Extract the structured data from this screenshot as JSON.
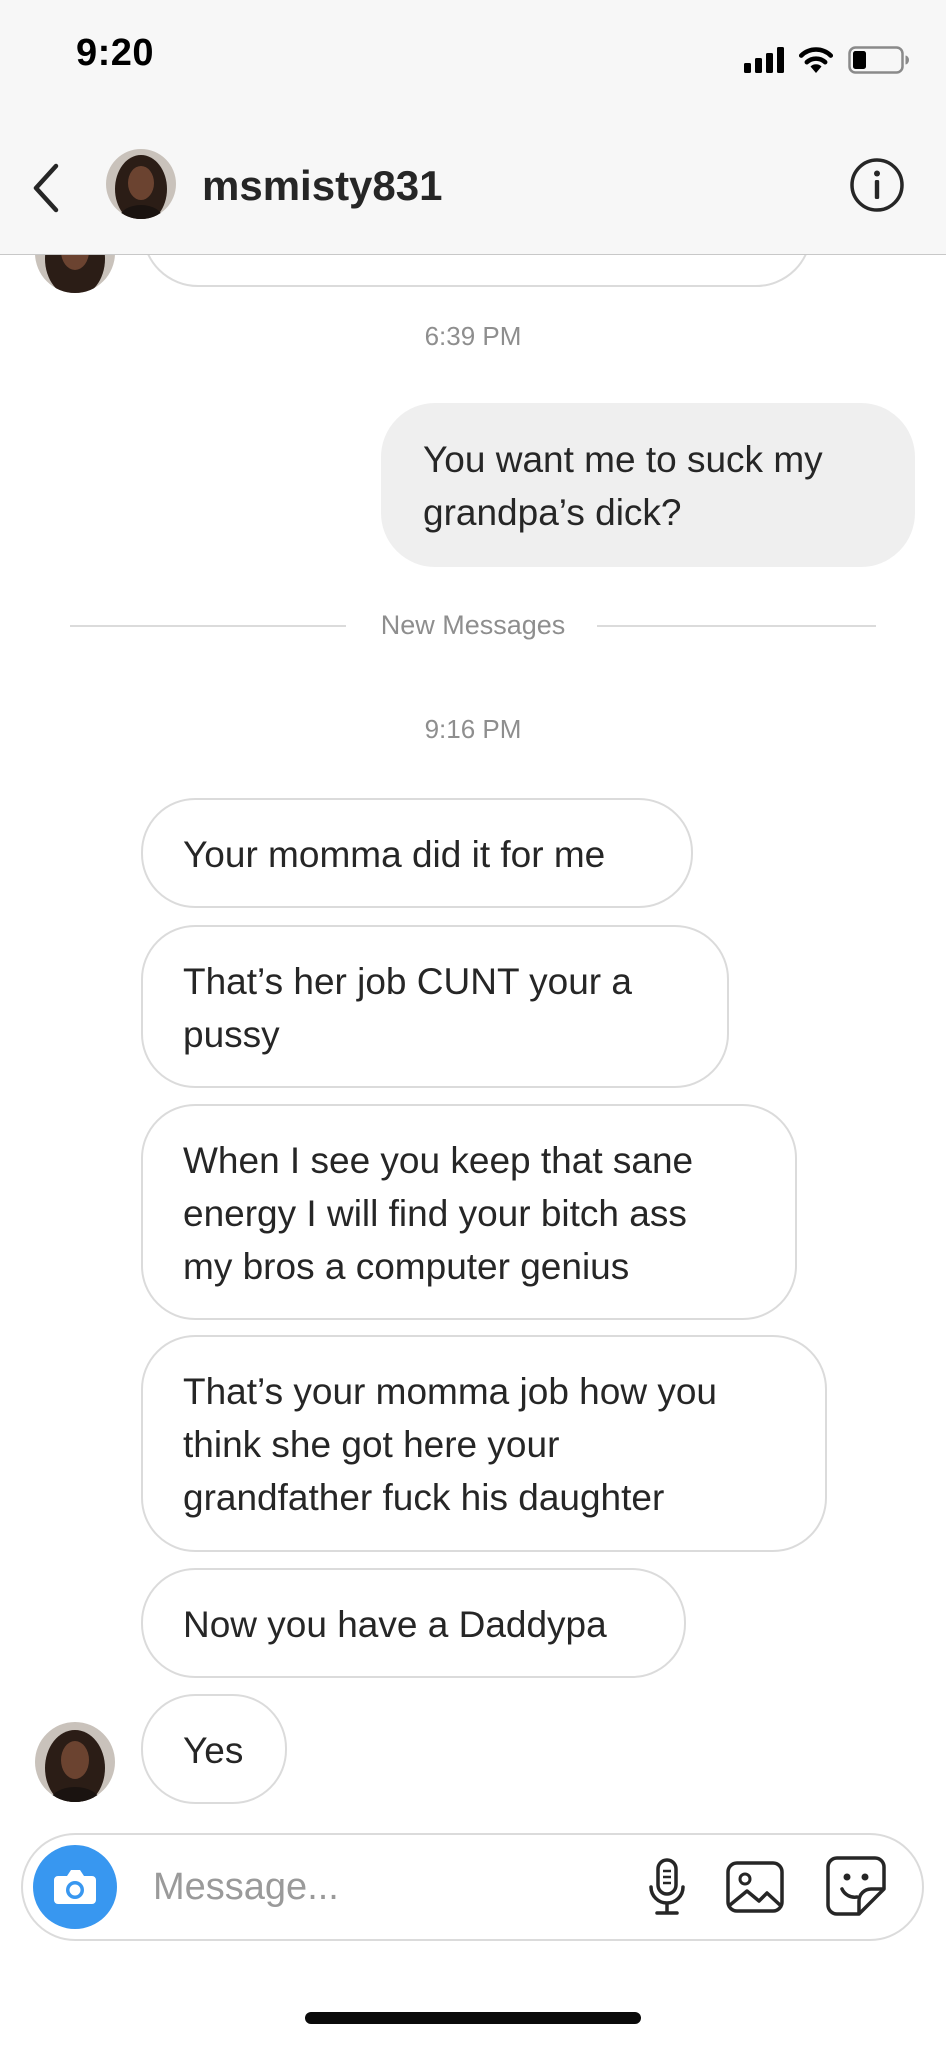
{
  "status_bar": {
    "time": "9:20",
    "icons": [
      "signal-icon",
      "wifi-icon",
      "battery-icon"
    ]
  },
  "header": {
    "username": "msmisty831",
    "back_icon": "chevron-left-icon",
    "info_icon": "info-icon"
  },
  "conversation": {
    "timestamp_1": "6:39 PM",
    "outgoing_message": "You want me to suck my\ngrandpa’s dick?",
    "new_messages_label": "New Messages",
    "timestamp_2": "9:16 PM",
    "incoming_messages": [
      "Your momma did it for me",
      "That’s her job CUNT your a\npussy",
      "When I see you keep that sane\nenergy I will find your bitch ass\nmy bros a computer genius",
      "That’s your momma job how you\nthink she got here your\ngrandfather fuck his daughter",
      "Now you have a Daddypa",
      "Yes"
    ]
  },
  "composer": {
    "placeholder": "Message...",
    "icons": [
      "camera-icon",
      "microphone-icon",
      "gallery-icon",
      "sticker-icon"
    ]
  },
  "colors": {
    "accent": "#3897f0",
    "bubble_border": "#dbdbdb",
    "outgoing_bubble": "#efefef",
    "secondary_text": "#8e8e8e"
  }
}
